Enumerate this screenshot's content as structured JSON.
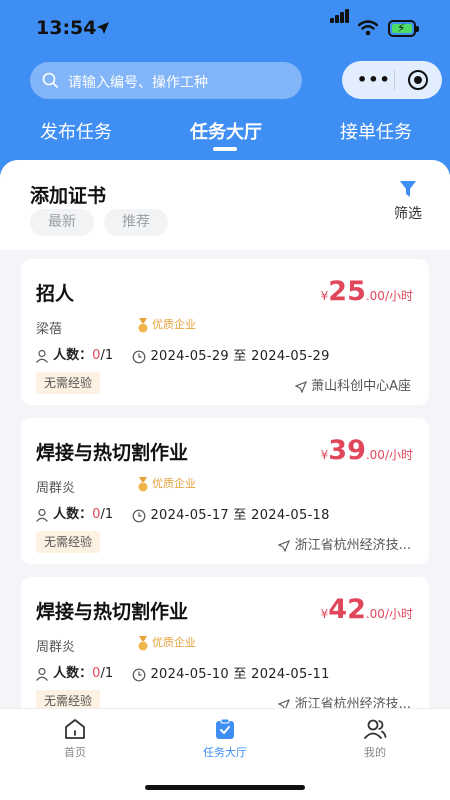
{
  "status_bar": {
    "time": "13:54"
  },
  "search": {
    "placeholder": "请输入编号、操作工种"
  },
  "tabs": [
    {
      "label": "发布任务"
    },
    {
      "label": "任务大厅"
    },
    {
      "label": "接单任务"
    }
  ],
  "section": {
    "title": "添加证书",
    "pills": [
      "最新",
      "推荐"
    ],
    "filter_label": "筛选"
  },
  "people_label": "人数：",
  "tasks": [
    {
      "title": "招人",
      "currency": "¥",
      "price": "25",
      "price_decimal": ".00",
      "unit": "/小时",
      "poster": "梁蓓",
      "quality_badge": "优质企业",
      "people_current": "0",
      "people_total": "/1",
      "date_range": "2024-05-29 至 2024-05-29",
      "experience": "无需经验",
      "address": "萧山科创中心A座"
    },
    {
      "title": "焊接与热切割作业",
      "currency": "¥",
      "price": "39",
      "price_decimal": ".00",
      "unit": "/小时",
      "poster": "周群炎",
      "quality_badge": "优质企业",
      "people_current": "0",
      "people_total": "/1",
      "date_range": "2024-05-17 至 2024-05-18",
      "experience": "无需经验",
      "address": "浙江省杭州经济技..."
    },
    {
      "title": "焊接与热切割作业",
      "currency": "¥",
      "price": "42",
      "price_decimal": ".00",
      "unit": "/小时",
      "poster": "周群炎",
      "quality_badge": "优质企业",
      "people_current": "0",
      "people_total": "/1",
      "date_range": "2024-05-10 至 2024-05-11",
      "experience": "无需经验",
      "address": "浙江省杭州经济技..."
    }
  ],
  "bottom_nav": [
    {
      "label": "首页",
      "icon": "home-icon"
    },
    {
      "label": "任务大厅",
      "icon": "clipboard-check-icon"
    },
    {
      "label": "我的",
      "icon": "user-icon"
    }
  ],
  "colors": {
    "primary": "#3f8ef4",
    "price": "#e0475b",
    "badge": "#e8a23a"
  }
}
